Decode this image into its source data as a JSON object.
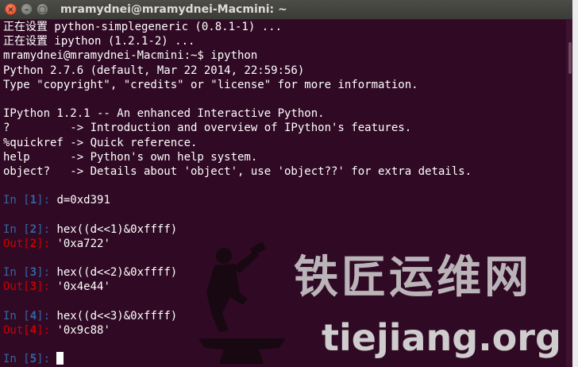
{
  "window": {
    "title": "mramydnei@mramydnei-Macmini: ~"
  },
  "controls": {
    "close": "×",
    "minimize": "–",
    "maximize": "▢"
  },
  "terminal": {
    "lines": [
      "正在设置 python-simplegeneric (0.8.1-1) ...",
      "正在设置 ipython (1.2.1-2) ...",
      "mramydnei@mramydnei-Macmini:~$ ipython",
      "Python 2.7.6 (default, Mar 22 2014, 22:59:56)",
      "Type \"copyright\", \"credits\" or \"license\" for more information.",
      "",
      "IPython 1.2.1 -- An enhanced Interactive Python.",
      "?         -> Introduction and overview of IPython's features.",
      "%quickref -> Quick reference.",
      "help      -> Python's own help system.",
      "object?   -> Details about 'object', use 'object??' for extra details."
    ],
    "cells": [
      {
        "in_prefix": "In [",
        "in_num": "1",
        "in_suffix": "]: ",
        "code": "d=0xd391"
      },
      {
        "in_prefix": "In [",
        "in_num": "2",
        "in_suffix": "]: ",
        "code": "hex((d<<1)&0xffff)",
        "out_prefix": "Out[",
        "out_num": "2",
        "out_suffix": "]: ",
        "output": "'0xa722'"
      },
      {
        "in_prefix": "In [",
        "in_num": "3",
        "in_suffix": "]: ",
        "code": "hex((d<<2)&0xffff)",
        "out_prefix": "Out[",
        "out_num": "3",
        "out_suffix": "]: ",
        "output": "'0x4e44'"
      },
      {
        "in_prefix": "In [",
        "in_num": "4",
        "in_suffix": "]: ",
        "code": "hex((d<<3)&0xffff)",
        "out_prefix": "Out[",
        "out_num": "4",
        "out_suffix": "]: ",
        "output": "'0x9c88'"
      },
      {
        "in_prefix": "In [",
        "in_num": "5",
        "in_suffix": "]: ",
        "code": ""
      }
    ]
  },
  "watermark": {
    "cn": "铁匠运维网",
    "en": "tiejiang.org"
  },
  "colors": {
    "background": "#300a24",
    "in_prompt": "#3465a4",
    "out_prompt": "#cc0000",
    "text": "#ffffff"
  }
}
